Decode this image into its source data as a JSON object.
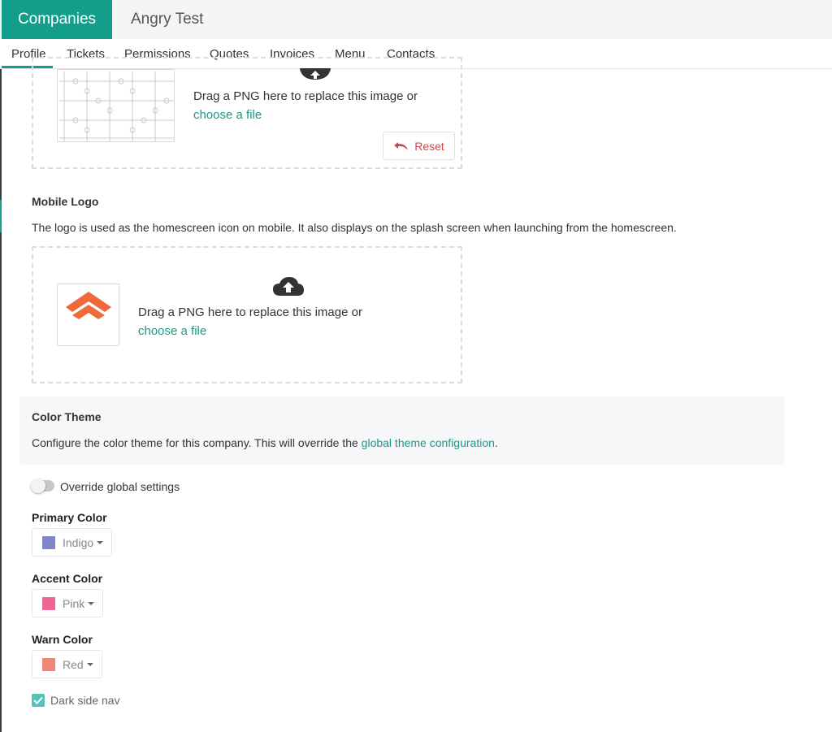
{
  "header": {
    "tabs": [
      {
        "label": "Companies",
        "active": true
      },
      {
        "label": "Angry Test",
        "active": false
      }
    ]
  },
  "subnav": {
    "tabs": [
      "Profile",
      "Tickets",
      "Permissions",
      "Quotes",
      "Invoices",
      "Menu",
      "Contacts"
    ],
    "active": "Profile"
  },
  "logo_upload": {
    "drop_text": "Drag a PNG here to replace this image or",
    "choose_link": "choose a file",
    "reset_label": "Reset"
  },
  "mobile_logo": {
    "title": "Mobile Logo",
    "description": "The logo is used as the homescreen icon on mobile. It also displays on the splash screen when launching from the homescreen.",
    "drop_text": "Drag a PNG here to replace this image or",
    "choose_link": "choose a file"
  },
  "color_theme": {
    "title": "Color Theme",
    "description_prefix": "Configure the color theme for this company. This will override the ",
    "description_link": "global theme configuration",
    "description_suffix": ".",
    "override_label": "Override global settings",
    "override_enabled": false
  },
  "colors": {
    "primary": {
      "label": "Primary Color",
      "value": "Indigo",
      "swatch": "#7e86c9"
    },
    "accent": {
      "label": "Accent Color",
      "value": "Pink",
      "swatch": "#ee6592"
    },
    "warn": {
      "label": "Warn Color",
      "value": "Red",
      "swatch": "#f2857a"
    }
  },
  "dark_side_nav": {
    "label": "Dark side nav",
    "checked": true
  },
  "brand_colors": {
    "teal": "#129e8a",
    "link": "#1a9a86",
    "reset": "#c94a4a",
    "logo_orange": "#ef6a3a"
  }
}
